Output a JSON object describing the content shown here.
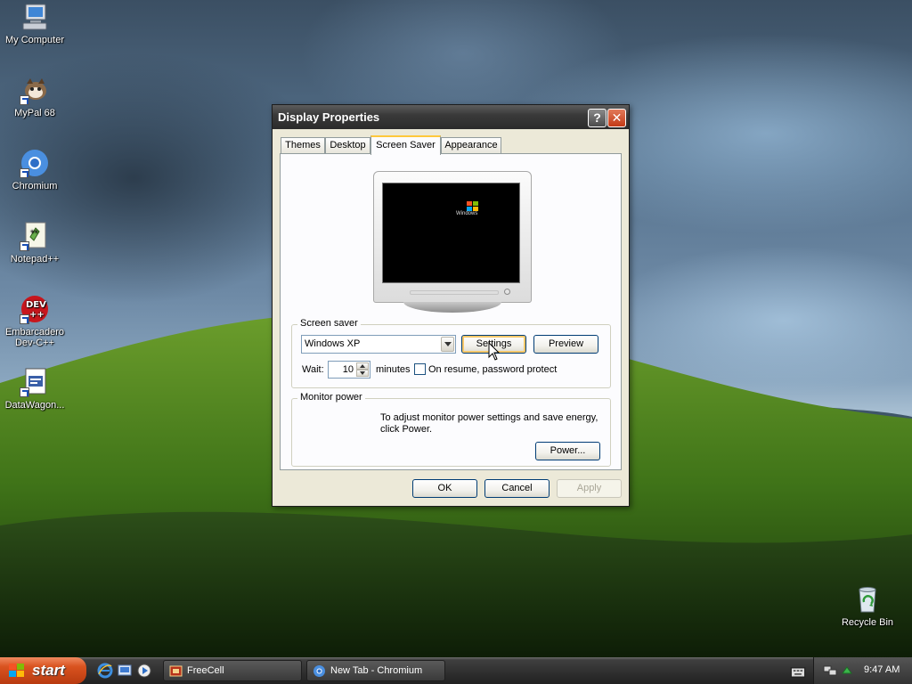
{
  "desktop": {
    "icons": [
      {
        "label": "My Computer"
      },
      {
        "label": "MyPal 68"
      },
      {
        "label": "Chromium"
      },
      {
        "label": "Notepad++"
      },
      {
        "label": "Embarcadero Dev-C++"
      },
      {
        "label": "DataWagon..."
      },
      {
        "label": "Recycle Bin"
      }
    ]
  },
  "dialog": {
    "title": "Display Properties",
    "help_button": "?",
    "close_button": "✕",
    "tabs": [
      {
        "label": "Themes"
      },
      {
        "label": "Desktop"
      },
      {
        "label": "Screen Saver"
      },
      {
        "label": "Appearance"
      }
    ],
    "active_tab": "Screen Saver",
    "preview": {
      "logo_text": "Windows"
    },
    "screen_saver": {
      "group_label": "Screen saver",
      "selected": "Windows XP",
      "settings_label": "Settings",
      "preview_label": "Preview",
      "wait_label": "Wait:",
      "wait_value": "10",
      "minutes_label": "minutes",
      "password_label": "On resume, password protect",
      "password_checked": false
    },
    "monitor_power": {
      "group_label": "Monitor power",
      "description": "To adjust monitor power settings and save energy, click Power.",
      "power_label": "Power..."
    },
    "buttons": {
      "ok": "OK",
      "cancel": "Cancel",
      "apply": "Apply"
    }
  },
  "taskbar": {
    "start_label": "start",
    "tasks": [
      {
        "label": "FreeCell"
      },
      {
        "label": "New Tab - Chromium"
      }
    ],
    "clock": "9:47 AM"
  },
  "colors": {
    "dialog_bg": "#ece9d8",
    "tab_accent": "#ffc83c",
    "start_button": "#d9531f",
    "button_border": "#003c74"
  }
}
